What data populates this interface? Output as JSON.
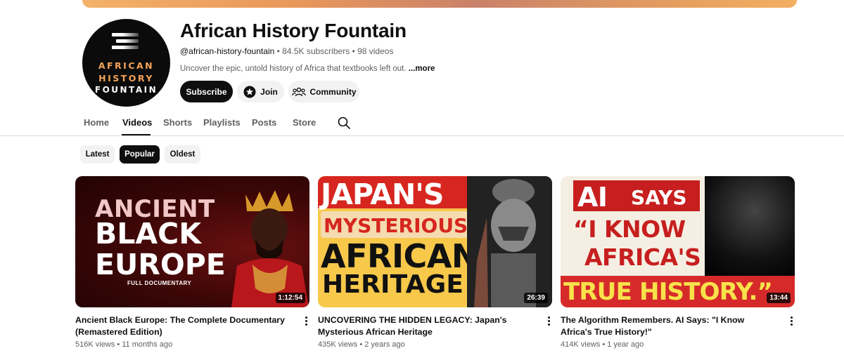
{
  "channel": {
    "name": "African History Fountain",
    "handle": "@african-history-fountain",
    "subscribers": "84.5K subscribers",
    "video_count": "98 videos",
    "description": "Uncover the epic, untold history of Africa that textbooks left out.",
    "more_label": "...more",
    "avatar_text": [
      "AFRICAN",
      "HISTORY",
      "FOUNTAIN"
    ]
  },
  "actions": {
    "subscribe": "Subscribe",
    "join": "Join",
    "community": "Community"
  },
  "tabs": [
    "Home",
    "Videos",
    "Shorts",
    "Playlists",
    "Posts",
    "Store"
  ],
  "active_tab": "Videos",
  "filters": [
    "Latest",
    "Popular",
    "Oldest"
  ],
  "active_filter": "Popular",
  "videos": [
    {
      "title": "Ancient Black Europe: The Complete Documentary (Remastered Edition)",
      "views": "516K views",
      "age": "11 months ago",
      "duration": "1:12:54",
      "thumb_text": [
        "ANCIENT",
        "BLACK",
        "EUROPE",
        "FULL DOCUMENTARY"
      ]
    },
    {
      "title": "UNCOVERING THE HIDDEN LEGACY: Japan's Mysterious African Heritage",
      "views": "435K views",
      "age": "2 years ago",
      "duration": "26:39",
      "thumb_text": [
        "JAPAN'S",
        "MYSTERIOUS",
        "AFRICAN",
        "HERITAGE"
      ]
    },
    {
      "title": "The Algorithm Remembers. AI Says: \"I Know Africa's True History!\"",
      "views": "414K views",
      "age": "1 year ago",
      "duration": "13:44",
      "thumb_text": [
        "AI",
        "SAYS",
        "“I KNOW",
        "AFRICA'S",
        "TRUE HISTORY.”"
      ]
    }
  ],
  "colors": {
    "accent_dark": "#0f0f0f",
    "chip_bg": "#f2f2f2",
    "secondary_text": "#606060",
    "logo_orange": "#f5a25a"
  },
  "icons": [
    "join-star-icon",
    "community-people-icon",
    "search-icon",
    "more-vert-icon"
  ]
}
